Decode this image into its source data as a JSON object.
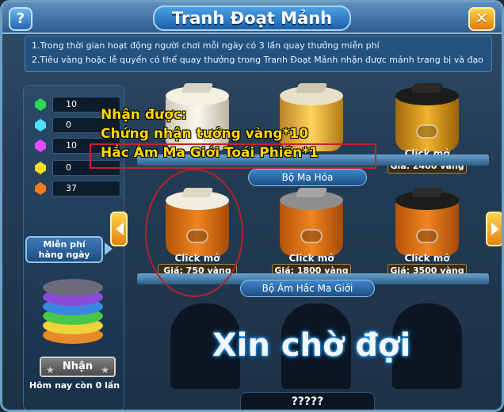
{
  "window": {
    "title": "Tranh Đoạt Mảnh",
    "help_label": "?",
    "close_label": "✕"
  },
  "notice": {
    "line1": "1.Trong thời gian hoạt động người chơi mỗi ngày có 3 lần quay thưởng miễn phí",
    "line2": "2.Tiêu vàng hoặc lễ quyển có thể quay thưởng trong Tranh Đoạt Mảnh nhận được mảnh trang bị và đạo"
  },
  "resources": [
    {
      "icon": "green-gem-icon",
      "color": "#2fd64f",
      "value": "10"
    },
    {
      "icon": "cyan-gem-icon",
      "color": "#4fe0ff",
      "value": "0"
    },
    {
      "icon": "purple-gem-icon",
      "color": "#e04cff",
      "value": "10"
    },
    {
      "icon": "yellow-gem-icon",
      "color": "#ffdb2a",
      "value": "0"
    },
    {
      "icon": "orange-gem-icon",
      "color": "#ff7a1c",
      "value": "37"
    }
  ],
  "left_panel": {
    "free_spin_label_1": "Miễn phí",
    "free_spin_label_2": "hàng ngày",
    "receive_label": "Nhận",
    "today_remaining": "Hôm nay còn 0 lần"
  },
  "shelves": [
    {
      "label": "Bộ Ma Hóa"
    },
    {
      "label": "Bộ Ám Hắc Ma Giới"
    }
  ],
  "drums": {
    "row1": [
      {
        "color": "white",
        "click": "",
        "price": ""
      },
      {
        "color": "gold",
        "click": "",
        "price": ""
      },
      {
        "color": "black",
        "click": "Click mở",
        "price": "Giá: 2400 vàng"
      }
    ],
    "row2": [
      {
        "color": "white",
        "click": "Click mở",
        "price": "Giá: 750 vàng"
      },
      {
        "color": "gray",
        "click": "Click mở",
        "price": "Giá: 1800 vàng"
      },
      {
        "color": "black",
        "click": "Click mở",
        "price": "Giá: 3500 vàng"
      }
    ]
  },
  "overlay": {
    "line1": "Nhận được:",
    "line2": "Chứng nhận tướng vàng*10",
    "line3": "Hắc Ám Ma Giới Toái Phiến*1"
  },
  "locked": {
    "wait_text": "Xin chờ đợi",
    "bottom_label": "?????"
  },
  "colors": {
    "annotation_red": "#c3242c",
    "overlay_yellow": "#ffd900",
    "drum_orange": "#e06a12"
  }
}
